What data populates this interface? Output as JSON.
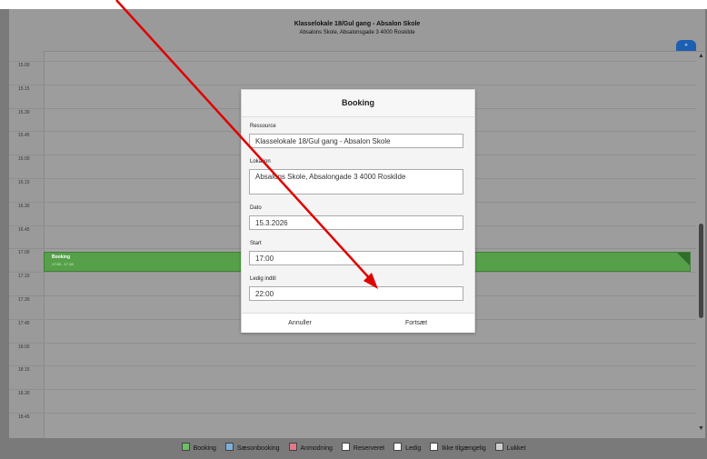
{
  "header": {
    "title": "Klasselokale 18/Gul gang - Absalon Skole",
    "subtitle": "Absalons Skole, Absalonsgade 3 4000 Roskilde",
    "pill_label": "»"
  },
  "time_slots": [
    "15.00",
    "15.15",
    "15.30",
    "15.45",
    "16.00",
    "16.15",
    "16.30",
    "16.45",
    "17.00",
    "17.15",
    "17.30",
    "17.45",
    "18.00",
    "18.15",
    "18.30",
    "18.45"
  ],
  "booking_event": {
    "title": "Booking",
    "time": "17.00 - 17.15"
  },
  "dialog": {
    "title": "Booking",
    "resource_label": "Ressource",
    "resource_value": "Klasselokale 18/Gul gang - Absalon Skole",
    "location_label": "Lokation",
    "location_value": "Absalons Skole, Absalongade 3 4000 Roskilde",
    "date_label": "Dato",
    "date_value": "15.3.2026",
    "start_label": "Start",
    "start_value": "17:00",
    "until_label": "Ledig indtil",
    "until_value": "22:00",
    "cancel_label": "Annuller",
    "continue_label": "Fortsæt"
  },
  "legend": [
    {
      "label": "Booking",
      "color": "#6cbf63"
    },
    {
      "label": "Sæsonbooking",
      "color": "#7fb0d9"
    },
    {
      "label": "Anmodning",
      "color": "#e07a8a"
    },
    {
      "label": "Reserveret",
      "color": "#ffffff"
    },
    {
      "label": "Ledig",
      "color": "#ffffff"
    },
    {
      "label": "Ikke tilgængelig",
      "color": "#ffffff"
    },
    {
      "label": "Lukket",
      "color": "#cfcfcf"
    }
  ],
  "colors": {
    "overlay": "#9d9d9d",
    "booking_green": "#56a04a",
    "arrow_red": "#e00000"
  }
}
